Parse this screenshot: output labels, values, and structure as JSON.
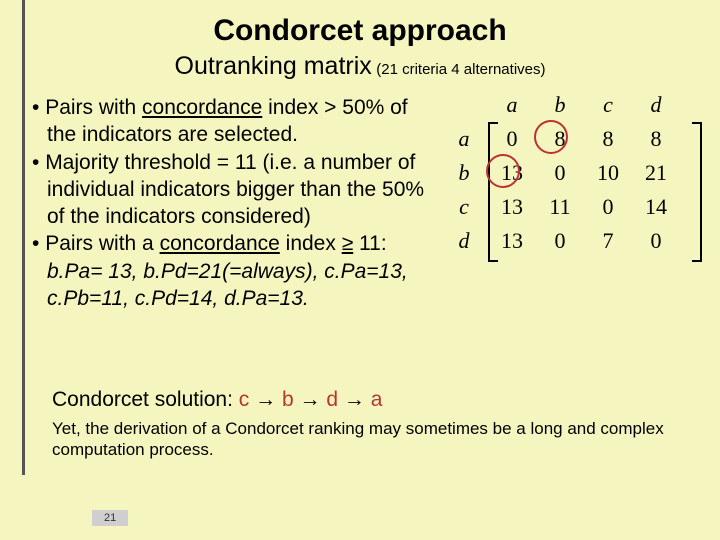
{
  "title": "Condorcet approach",
  "subtitle": "Outranking matrix",
  "subtitle_note": " (21 criteria 4 alternatives)",
  "bullets": {
    "b1_pre": "Pairs with ",
    "b1_ul": "concordance",
    "b1_post": " index > 50% of the indicators are selected.",
    "b2": "Majority threshold = 11 (i.e. a number of individual indicators bigger than the 50% of the indicators considered)",
    "b3_pre": "Pairs with a ",
    "b3_ul": "concordance",
    "b3_mid": " index ",
    "b3_ge": "≥",
    "b3_num": " 11: ",
    "b3_examples": "b.Pa= 13, b.Pd=21(=always), c.Pa=13, c.Pb=11, c.Pd=14, d.Pa=13."
  },
  "solution": {
    "label": "Condorcet solution: ",
    "c": "c",
    "b": "b",
    "d": "d",
    "a": "a"
  },
  "caveat": "Yet, the derivation of a Condorcet ranking may sometimes be a long and complex computation process.",
  "matrix": {
    "row_labels": [
      "a",
      "b",
      "c",
      "d"
    ],
    "col_labels": [
      "a",
      "b",
      "c",
      "d"
    ],
    "cells": {
      "r0c0": "0",
      "r0c1": "8",
      "r0c2": "8",
      "r0c3": "8",
      "r1c0": "13",
      "r1c1": "0",
      "r1c2": "10",
      "r1c3": "21",
      "r2c0": "13",
      "r2c1": "11",
      "r2c2": "0",
      "r2c3": "14",
      "r3c0": "13",
      "r3c1": "0",
      "r3c2": "7",
      "r3c3": "0"
    }
  },
  "page_number": "21"
}
